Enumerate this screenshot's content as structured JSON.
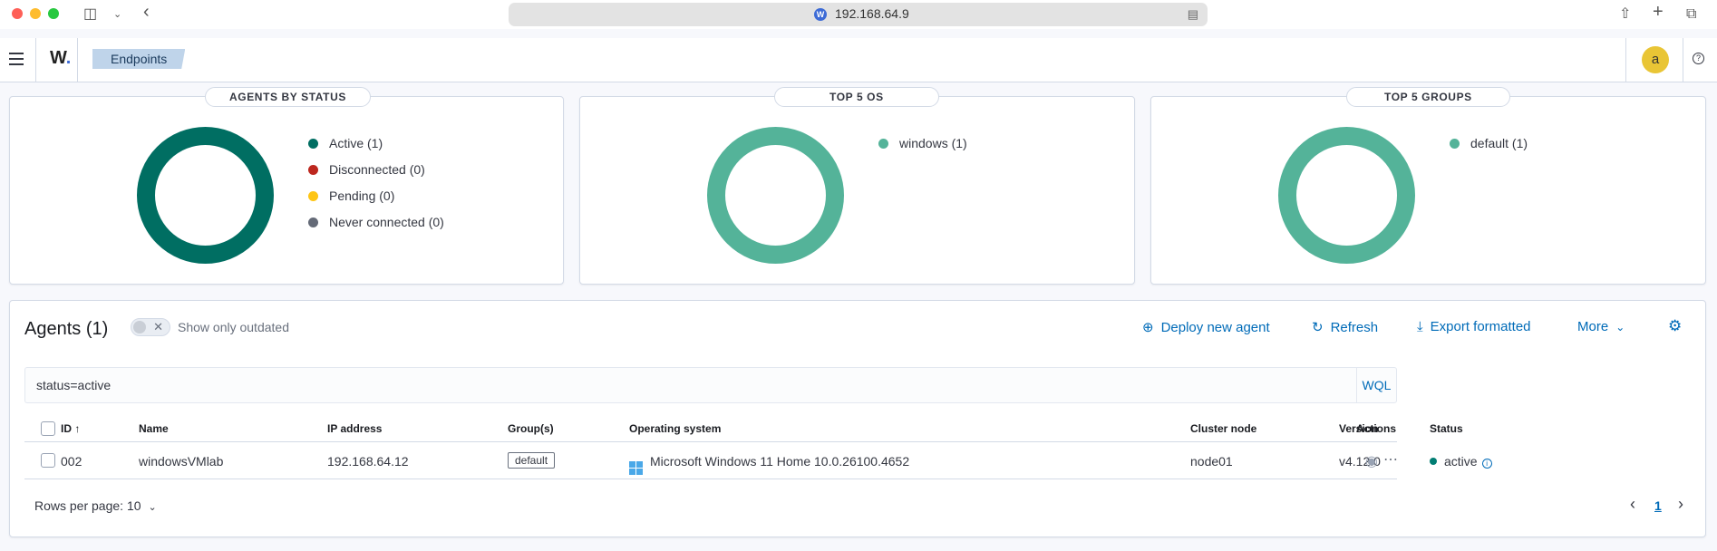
{
  "browser": {
    "url": "192.168.64.9"
  },
  "header": {
    "logo_text": "W",
    "breadcrumb": "Endpoints",
    "avatar_letter": "a",
    "help_glyph": "?"
  },
  "panels": [
    {
      "title": "AGENTS BY STATUS",
      "legend": [
        {
          "label": "Active (1)",
          "color": "#006e62"
        },
        {
          "label": "Disconnected (0)",
          "color": "#bd271e"
        },
        {
          "label": "Pending (0)",
          "color": "#fec514"
        },
        {
          "label": "Never connected (0)",
          "color": "#646a77"
        }
      ],
      "donut_color": "#006e62"
    },
    {
      "title": "TOP 5 OS",
      "legend": [
        {
          "label": "windows (1)",
          "color": "#54b399"
        }
      ],
      "donut_color": "#54b399"
    },
    {
      "title": "TOP 5 GROUPS",
      "legend": [
        {
          "label": "default (1)",
          "color": "#54b399"
        }
      ],
      "donut_color": "#54b399"
    }
  ],
  "agents": {
    "title": "Agents (1)",
    "toggle_label": "Show only outdated",
    "actions": {
      "deploy": "Deploy new agent",
      "refresh": "Refresh",
      "export": "Export formatted",
      "more": "More"
    },
    "search_value": "status=active",
    "wql_label": "WQL",
    "columns": [
      "ID",
      "Name",
      "IP address",
      "Group(s)",
      "Operating system",
      "Cluster node",
      "Version",
      "Status",
      "Actions"
    ],
    "rows": [
      {
        "id": "002",
        "name": "windowsVMlab",
        "ip": "192.168.64.12",
        "group": "default",
        "os": "Microsoft Windows 11 Home 10.0.26100.4652",
        "cluster_node": "node01",
        "version": "v4.12.0",
        "status": "active"
      }
    ],
    "rows_per_page": "Rows per page: 10",
    "current_page": "1"
  }
}
